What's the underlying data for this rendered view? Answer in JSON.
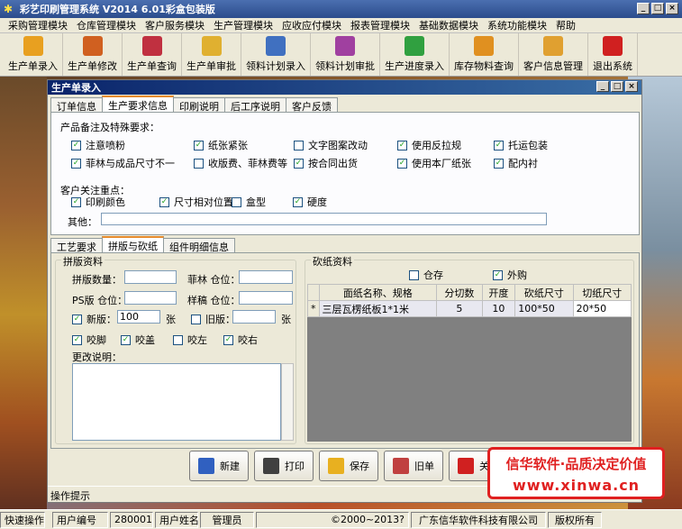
{
  "window": {
    "title": "彩艺印刷管理系统  V2014  6.01彩盒包装版"
  },
  "menu": [
    "采购管理模块",
    "仓库管理模块",
    "客户服务模块",
    "生产管理模块",
    "应收应付模块",
    "报表管理模块",
    "基础数据模块",
    "系统功能模块",
    "帮助"
  ],
  "toolbar": [
    {
      "label": "生产单录入",
      "icon": "box-icon",
      "color": "#e8a020"
    },
    {
      "label": "生产单修改",
      "icon": "box-edit-icon",
      "color": "#d06020"
    },
    {
      "label": "生产单查询",
      "icon": "fruit-icon",
      "color": "#c03040"
    },
    {
      "label": "生产单审批",
      "icon": "shopping-bag-icon",
      "color": "#e0b030"
    },
    {
      "label": "领料计划录入",
      "icon": "hand-cursor-icon",
      "color": "#4070c0"
    },
    {
      "label": "领料计划审批",
      "icon": "blocks-icon",
      "color": "#a040a0"
    },
    {
      "label": "生产进度录入",
      "icon": "bar-chart-icon",
      "color": "#30a040"
    },
    {
      "label": "库存物料查询",
      "icon": "coins-icon",
      "color": "#e09020"
    },
    {
      "label": "客户信息管理",
      "icon": "package-icon",
      "color": "#e0a030"
    },
    {
      "label": "退出系统",
      "icon": "power-icon",
      "color": "#d02020"
    }
  ],
  "child": {
    "title": "生产单录入"
  },
  "top_tabs": [
    "订单信息",
    "生产要求信息",
    "印刷说明",
    "后工序说明",
    "客户反馈"
  ],
  "requirements": {
    "heading": "产品备注及特殊要求：",
    "items": [
      {
        "label": "注意喷粉",
        "checked": true
      },
      {
        "label": "纸张紧张",
        "checked": true
      },
      {
        "label": "文字图案改动",
        "checked": false
      },
      {
        "label": "使用反拉规",
        "checked": true
      },
      {
        "label": "托运包装",
        "checked": true
      },
      {
        "label": "菲林与成品尺寸不一",
        "checked": true
      },
      {
        "label": "收版费、菲林费等",
        "checked": false
      },
      {
        "label": "按合同出货",
        "checked": true
      },
      {
        "label": "使用本厂纸张",
        "checked": true
      },
      {
        "label": "配内衬",
        "checked": true
      }
    ],
    "focus_heading": "客户关注重点：",
    "focus": [
      {
        "label": "印刷颜色",
        "checked": true
      },
      {
        "label": "尺寸相对位置",
        "checked": true
      },
      {
        "label": "盒型",
        "checked": false
      },
      {
        "label": "硬度",
        "checked": true
      }
    ],
    "other_label": "其他：",
    "other_value": ""
  },
  "sub_tabs": [
    "工艺要求",
    "拼版与砍纸",
    "组件明细信息"
  ],
  "impose": {
    "group_title": "拼版资料",
    "count_label": "拼版数量：",
    "count_value": "",
    "film_label": "菲林 仓位：",
    "film_value": "",
    "ps_label": "PS版 仓位：",
    "ps_value": "",
    "sample_label": "样稿 仓位：",
    "sample_value": "",
    "new_label": "新版：",
    "new_checked": true,
    "new_value": "100",
    "new_unit": "张",
    "old_label": "旧版：",
    "old_checked": false,
    "old_value": "",
    "old_unit": "张",
    "bite": [
      {
        "label": "咬脚",
        "checked": true
      },
      {
        "label": "咬盖",
        "checked": true
      },
      {
        "label": "咬左",
        "checked": false
      },
      {
        "label": "咬右",
        "checked": true
      }
    ],
    "note_label": "更改说明：",
    "note_value": ""
  },
  "cut": {
    "group_title": "砍纸资料",
    "stock_label": "仓存",
    "stock_checked": false,
    "buy_label": "外购",
    "buy_checked": true,
    "headers": [
      "面纸名称、规格",
      "分切数",
      "开度",
      "砍纸尺寸",
      "切纸尺寸"
    ],
    "rows": [
      {
        "marker": "*",
        "name": "三层瓦楞纸板1*1米",
        "split": "5",
        "open": "10",
        "cut_size": "100*50",
        "trim_size": "20*50"
      }
    ]
  },
  "buttons": [
    {
      "label": "新建",
      "icon": "new-doc-icon"
    },
    {
      "label": "打印",
      "icon": "printer-icon"
    },
    {
      "label": "保存",
      "icon": "save-icon"
    },
    {
      "label": "旧单",
      "icon": "old-order-icon"
    },
    {
      "label": "关闭",
      "icon": "close-icon"
    }
  ],
  "hint": "操作提示",
  "promo": {
    "line1": "信华软件·品质决定价值",
    "line2": "www.xinwa.cn"
  },
  "status": {
    "quick": "快速操作",
    "user_no_label": "用户编号",
    "user_no": "280001",
    "user_name_label": "用户姓名",
    "user_name": "管理员",
    "copyright": "©2000~2013?",
    "company": "广东信华软件科技有限公司",
    "rights": "版权所有"
  }
}
